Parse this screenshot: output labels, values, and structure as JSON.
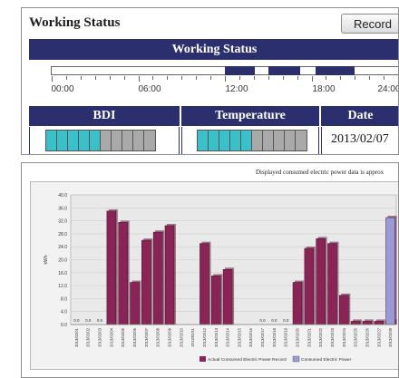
{
  "working_status": {
    "title": "Working Status",
    "record_button": "Record",
    "header": "Working Status",
    "timeline": {
      "labels": [
        "00:00",
        "06:00",
        "12:00",
        "18:00",
        "24:00"
      ],
      "active_ranges_hours": [
        [
          12.0,
          14.1
        ],
        [
          15.0,
          17.2
        ],
        [
          18.3,
          21.0
        ]
      ]
    },
    "columns": {
      "bdi": "BDI",
      "temperature": "Temperature",
      "date": "Date"
    },
    "bdi_level": {
      "filled": 5,
      "total": 10
    },
    "temperature_level": {
      "filled": 5,
      "total": 10
    },
    "date_value": "2013/02/07"
  },
  "power_chart": {
    "note": "Displayed consumed electric power data is approx",
    "legend": [
      "Actual Consumed Electric Power Record",
      "Consumed Electric Power"
    ],
    "colors": {
      "actual": "#8b2456",
      "consumed": "#9a9ad6"
    }
  },
  "chart_data": {
    "type": "bar",
    "ylabel": "kWh",
    "ylim": [
      0,
      40
    ],
    "yticks": [
      "0.0",
      "4.0",
      "8.0",
      "12.0",
      "16.0",
      "20.0",
      "24.0",
      "28.0",
      "32.0",
      "36.0",
      "40.0"
    ],
    "categories": [
      "2013/02/01",
      "2013/02/02",
      "2013/02/03",
      "2013/02/04",
      "2013/02/05",
      "2013/02/06",
      "2013/02/07",
      "2013/02/08",
      "2013/02/09",
      "2013/02/10",
      "2013/02/11",
      "2013/02/12",
      "2013/02/13",
      "2013/02/14",
      "2013/02/15",
      "2013/02/16",
      "2013/02/17",
      "2013/02/18",
      "2013/02/19",
      "2013/02/20",
      "2013/02/21",
      "2013/02/22",
      "2013/02/23",
      "2013/02/24",
      "2013/02/25",
      "2013/02/26",
      "2013/02/27",
      "2013/02/28"
    ],
    "series": [
      {
        "name": "Actual Consumed Electric Power Record",
        "values": [
          0.0,
          0.0,
          0.0,
          35.0,
          31.5,
          13.0,
          26.0,
          28.5,
          30.5,
          0,
          0,
          25.0,
          15.0,
          17.0,
          0,
          0,
          0.0,
          0.0,
          0.0,
          13.0,
          23.5,
          26.5,
          25.0,
          9.0,
          1.0,
          1.0,
          1.0,
          1.0
        ]
      },
      {
        "name": "Consumed Electric Power",
        "values": [
          0,
          0,
          0,
          0,
          0,
          0,
          0,
          0,
          0,
          0,
          0,
          0,
          0,
          0,
          0,
          0,
          0,
          0,
          0,
          0,
          0,
          0,
          0,
          0,
          0,
          0,
          0,
          33.0
        ]
      }
    ],
    "data_labels": [
      "0.0",
      "0.0",
      "0.0",
      "",
      "",
      "",
      "",
      "",
      "",
      "",
      "",
      "",
      "",
      "",
      "",
      "",
      "0.0",
      "0.0",
      "0.0",
      "",
      "",
      "",
      "",
      "",
      "",
      "",
      "",
      ""
    ]
  }
}
